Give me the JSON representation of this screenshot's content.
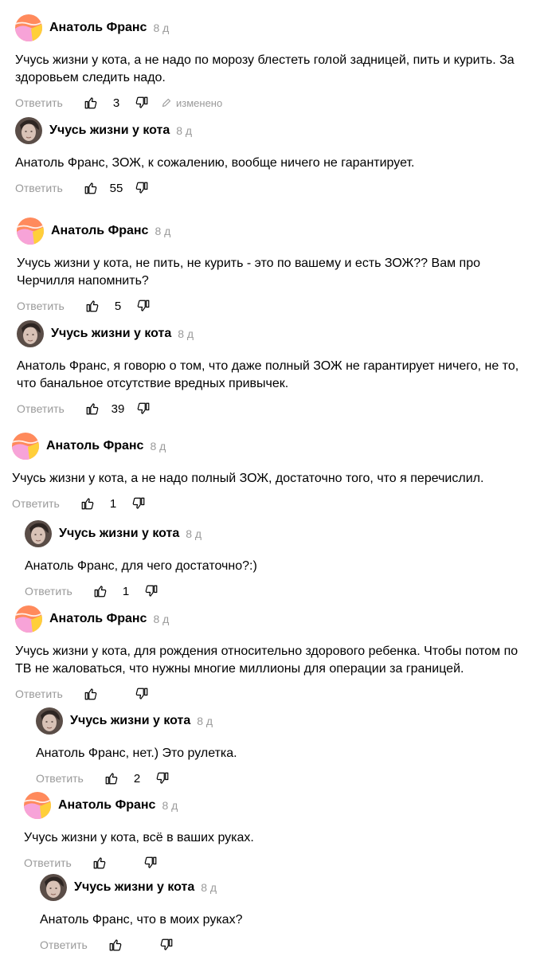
{
  "labels": {
    "reply": "Ответить"
  },
  "comments": [
    {
      "author": "Анатоль Франс",
      "age": "8 д",
      "text": "Учусь жизни у кота, а не надо по морозу блестеть голой задницей, пить и курить. За здоровьем следить надо.",
      "likes": "3",
      "edited": "изменено",
      "avatar": "af"
    },
    {
      "author": "Учусь жизни у кота",
      "age": "8 д",
      "text": "Анатоль Франс, ЗОЖ, к сожалению, вообще ничего не гарантирует.",
      "likes": "55",
      "avatar": "cat"
    },
    {
      "author": "Анатоль Франс",
      "age": "8 д",
      "text": "Учусь жизни у кота, не пить, не курить - это по вашему и есть ЗОЖ?? Вам про Черчилля напомнить?",
      "likes": "5",
      "avatar": "af"
    },
    {
      "author": "Учусь жизни у кота",
      "age": "8 д",
      "text": "Анатоль Франс, я говорю о том, что даже полный ЗОЖ не гарантирует ничего, не то, что банальное отсутствие вредных привычек.",
      "likes": "39",
      "avatar": "cat"
    },
    {
      "author": "Анатоль Франс",
      "age": "8 д",
      "text": "Учусь жизни у кота, а не надо полный ЗОЖ, достаточно того, что я перечислил.",
      "likes": "1",
      "avatar": "af"
    },
    {
      "author": "Учусь жизни у кота",
      "age": "8 д",
      "text": "Анатоль Франс, для чего достаточно?:)",
      "likes": "1",
      "avatar": "cat"
    },
    {
      "author": "Анатоль Франс",
      "age": "8 д",
      "text": "Учусь жизни у кота, для рождения относительно здорового ребенка. Чтобы потом по ТВ не жаловаться, что нужны многие миллионы для операции за границей.",
      "likes": "",
      "avatar": "af"
    },
    {
      "author": "Учусь жизни у кота",
      "age": "8 д",
      "text": "Анатоль Франс, нет.) Это рулетка.",
      "likes": "2",
      "avatar": "cat"
    },
    {
      "author": "Анатоль Франс",
      "age": "8 д",
      "text": "Учусь жизни у кота, всё в ваших руках.",
      "likes": "",
      "avatar": "af"
    },
    {
      "author": "Учусь жизни у кота",
      "age": "8 д",
      "text": "Анатоль Франс, что в моих руках?",
      "likes": "",
      "avatar": "cat"
    }
  ]
}
